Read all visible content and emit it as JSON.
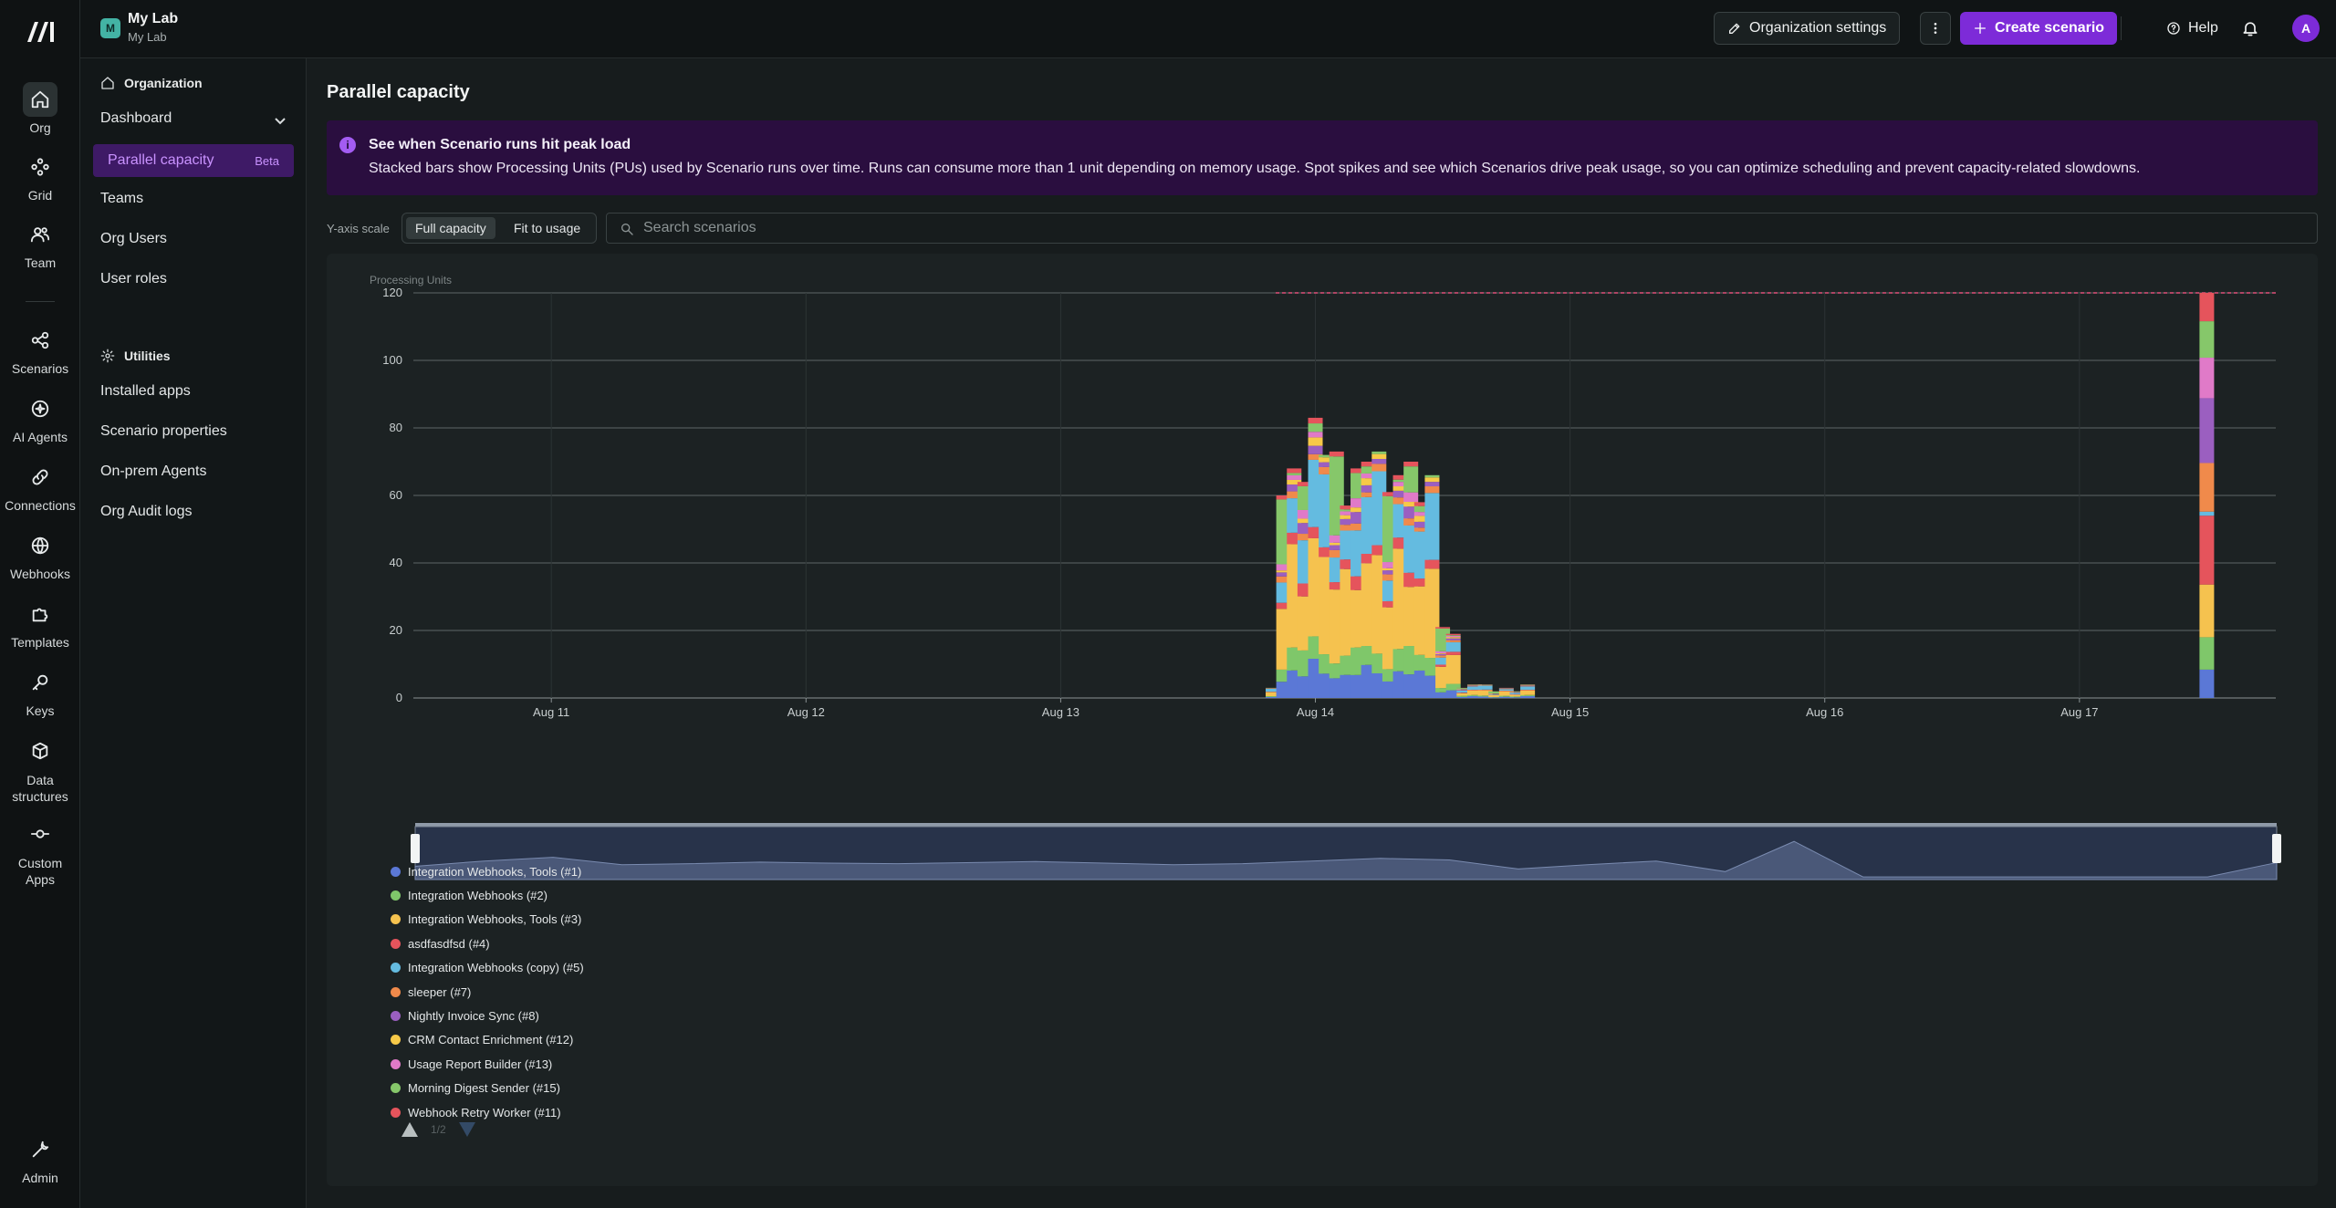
{
  "header": {
    "org_badge": "M",
    "org_name": "My Lab",
    "org_sub": "My Lab",
    "org_settings_label": "Organization settings",
    "create_label": "Create scenario",
    "help_label": "Help",
    "avatar": "A"
  },
  "rail": {
    "items": [
      {
        "label": "Org",
        "icon": "home-icon"
      },
      {
        "label": "Grid",
        "icon": "grid-icon"
      },
      {
        "label": "Team",
        "icon": "team-icon"
      },
      {
        "label": "Scenarios",
        "icon": "scenarios-icon"
      },
      {
        "label": "AI Agents",
        "icon": "ai-agents-icon"
      },
      {
        "label": "Connections",
        "icon": "link-icon"
      },
      {
        "label": "Webhooks",
        "icon": "globe-icon"
      },
      {
        "label": "Templates",
        "icon": "puzzle-icon"
      },
      {
        "label": "Keys",
        "icon": "key-icon"
      },
      {
        "label": "Data structures",
        "icon": "cube-icon"
      },
      {
        "label": "Custom Apps",
        "icon": "custom-apps-icon"
      },
      {
        "label": "Admin",
        "icon": "wrench-icon"
      }
    ]
  },
  "sidebar": {
    "org_heading": "Organization",
    "dashboard": "Dashboard",
    "active_item": "Parallel capacity",
    "beta": "Beta",
    "items": [
      "Teams",
      "Org Users",
      "User roles"
    ],
    "utilities_heading": "Utilities",
    "utilities": [
      "Installed apps",
      "Scenario properties",
      "On-prem Agents",
      "Org Audit logs"
    ]
  },
  "main": {
    "title": "Parallel capacity",
    "banner_title": "See when Scenario runs hit peak load",
    "banner_text": "Stacked bars show Processing Units (PUs) used by Scenario runs over time. Runs can consume more than 1 unit depending on memory usage. Spot spikes and see which Scenarios drive peak usage, so you can optimize scheduling and prevent capacity-related slowdowns.",
    "yaxis_scale_label": "Y-axis scale",
    "scale_full": "Full capacity",
    "scale_fit": "Fit to usage",
    "search_placeholder": "Search scenarios",
    "pager": "1/2"
  },
  "chart_data": {
    "type": "bar",
    "stacked": true,
    "ylabel": "Processing Units",
    "ylim": [
      0,
      120
    ],
    "yticks": [
      0,
      20,
      40,
      60,
      80,
      100,
      120
    ],
    "xticks": [
      "Aug 11",
      "Aug 12",
      "Aug 13",
      "Aug 14",
      "Aug 15",
      "Aug 16",
      "Aug 17"
    ],
    "capacity_line": 120,
    "series": [
      {
        "name": "Integration Webhooks, Tools (#1)",
        "color": "#5b78d6"
      },
      {
        "name": "Integration Webhooks (#2)",
        "color": "#7fc76a"
      },
      {
        "name": "Integration Webhooks, Tools (#3)",
        "color": "#f5c24f"
      },
      {
        "name": "asdfasdfsd (#4)",
        "color": "#e5545c"
      },
      {
        "name": "Integration Webhooks (copy) (#5)",
        "color": "#64bbe0"
      },
      {
        "name": "sleeper (#7)",
        "color": "#f08a4b"
      },
      {
        "name": "Nightly Invoice Sync (#8)",
        "color": "#9b5fc0"
      },
      {
        "name": "CRM Contact Enrichment (#12)",
        "color": "#f7c948"
      },
      {
        "name": "Usage Report Builder (#13)",
        "color": "#e07ac8"
      },
      {
        "name": "Morning Digest Sender (#15)",
        "color": "#86c76a"
      },
      {
        "name": "Webhook Retry Worker (#11)",
        "color": "#e5545c"
      }
    ],
    "bars": [
      {
        "x": "Aug 13 20:00",
        "total": 3
      },
      {
        "x": "Aug 13 21:00",
        "total": 60
      },
      {
        "x": "Aug 13 22:00",
        "total": 68
      },
      {
        "x": "Aug 13 23:00",
        "total": 64
      },
      {
        "x": "Aug 14 00:00",
        "total": 83
      },
      {
        "x": "Aug 14 01:00",
        "total": 72
      },
      {
        "x": "Aug 14 02:00",
        "total": 73
      },
      {
        "x": "Aug 14 03:00",
        "total": 57
      },
      {
        "x": "Aug 14 04:00",
        "total": 68
      },
      {
        "x": "Aug 14 05:00",
        "total": 70
      },
      {
        "x": "Aug 14 06:00",
        "total": 73
      },
      {
        "x": "Aug 14 07:00",
        "total": 61
      },
      {
        "x": "Aug 14 08:00",
        "total": 66
      },
      {
        "x": "Aug 14 09:00",
        "total": 70
      },
      {
        "x": "Aug 14 10:00",
        "total": 58
      },
      {
        "x": "Aug 14 11:00",
        "total": 66
      },
      {
        "x": "Aug 14 12:00",
        "total": 21
      },
      {
        "x": "Aug 14 13:00",
        "total": 19
      },
      {
        "x": "Aug 14 14:00",
        "total": 3
      },
      {
        "x": "Aug 14 15:00",
        "total": 4
      },
      {
        "x": "Aug 14 16:00",
        "total": 4
      },
      {
        "x": "Aug 14 17:00",
        "total": 2
      },
      {
        "x": "Aug 14 18:00",
        "total": 3
      },
      {
        "x": "Aug 14 19:00",
        "total": 2
      },
      {
        "x": "Aug 14 20:00",
        "total": 4
      },
      {
        "x": "Aug 17 12:00",
        "total": 120
      }
    ],
    "legend_position": "bottom-left"
  }
}
